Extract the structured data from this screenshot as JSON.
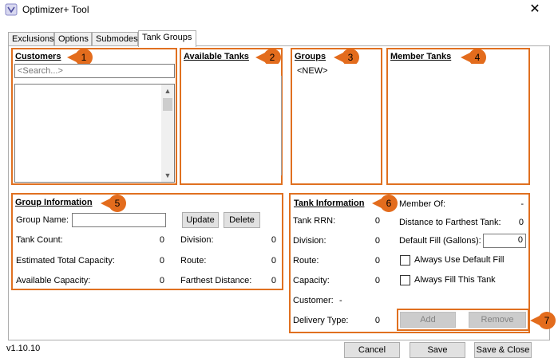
{
  "window": {
    "title": "Optimizer+ Tool",
    "close_symbol": "✕"
  },
  "tabs": [
    {
      "label": "Exclusions"
    },
    {
      "label": "Options"
    },
    {
      "label": "Submodes"
    },
    {
      "label": "Tank Groups",
      "active": true
    }
  ],
  "customers": {
    "title": "Customers",
    "search_placeholder": "<Search...>"
  },
  "available_tanks": {
    "title": "Available Tanks"
  },
  "groups": {
    "title": "Groups",
    "items": [
      "<NEW>"
    ]
  },
  "member_tanks": {
    "title": "Member Tanks"
  },
  "group_info": {
    "title": "Group Information",
    "group_name_label": "Group Name:",
    "group_name_value": "",
    "update_label": "Update",
    "delete_label": "Delete",
    "tank_count_label": "Tank Count:",
    "tank_count_value": "0",
    "division_label": "Division:",
    "division_value": "0",
    "est_capacity_label": "Estimated Total Capacity:",
    "est_capacity_value": "0",
    "route_label": "Route:",
    "route_value": "0",
    "avail_capacity_label": "Available Capacity:",
    "avail_capacity_value": "0",
    "farthest_label": "Farthest Distance:",
    "farthest_value": "0"
  },
  "tank_info": {
    "title": "Tank Information",
    "rrn_label": "Tank RRN:",
    "rrn_value": "0",
    "division_label": "Division:",
    "division_value": "0",
    "route_label": "Route:",
    "route_value": "0",
    "capacity_label": "Capacity:",
    "capacity_value": "0",
    "customer_label": "Customer:",
    "customer_value": "-",
    "delivery_label": "Delivery Type:",
    "delivery_value": "0",
    "member_of_label": "Member Of:",
    "member_of_value": "-",
    "dist_farthest_label": "Distance to Farthest Tank:",
    "dist_farthest_value": "0",
    "default_fill_label": "Default Fill (Gallons):",
    "default_fill_value": "0",
    "always_default_label": "Always Use Default Fill",
    "always_fill_label": "Always Fill This Tank",
    "add_label": "Add",
    "remove_label": "Remove"
  },
  "markers": [
    "1",
    "2",
    "3",
    "4",
    "5",
    "6",
    "7"
  ],
  "footer": {
    "version": "v1.10.10",
    "cancel_label": "Cancel",
    "save_label": "Save",
    "save_close_label": "Save & Close"
  },
  "colors": {
    "highlight": "#e07020",
    "marker": "#e36c1d"
  }
}
